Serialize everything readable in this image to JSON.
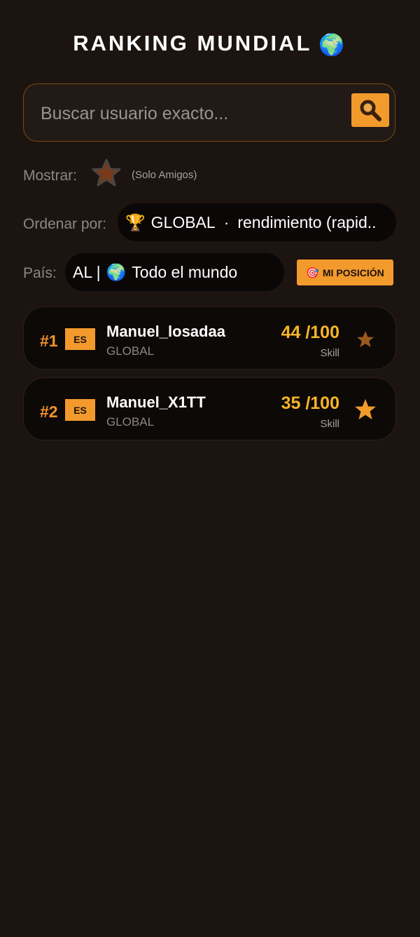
{
  "header": {
    "title": "RANKING MUNDIAL",
    "globe_icon": "🌍"
  },
  "search": {
    "placeholder": "Buscar usuario exacto...",
    "value": ""
  },
  "filters": {
    "show_label": "Mostrar:",
    "show_hint": "(Solo Amigos)",
    "sort_label": "Ordenar por:",
    "sort_icon": "🏆",
    "sort_scope": "GLOBAL",
    "sort_separator": "·",
    "sort_mode": "rendimiento (rapid..",
    "country_label": "País:",
    "country_code": "AL |",
    "country_icon": "🌍",
    "country_name": "Todo el mundo",
    "my_position_icon": "🎯",
    "my_position_label": "MI POSICIÓN"
  },
  "ranking": [
    {
      "rank": "#1",
      "country": "ES",
      "username": "Manuel_losadaa",
      "tag": "GLOBAL",
      "score": "44 /100",
      "score_label": "Skill",
      "favorite": false
    },
    {
      "rank": "#2",
      "country": "ES",
      "username": "Manuel_X1TT",
      "tag": "GLOBAL",
      "score": "35 /100",
      "score_label": "Skill",
      "favorite": true
    }
  ],
  "colors": {
    "background": "#1c1410",
    "accent": "#f39a2d",
    "score": "#f7b526",
    "row_bg": "#0d0907"
  }
}
